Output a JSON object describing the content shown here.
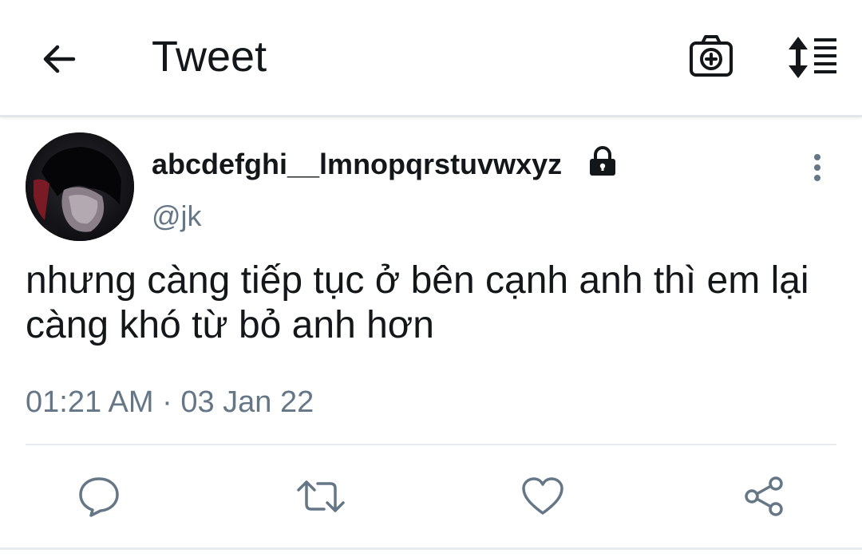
{
  "header": {
    "title": "Tweet",
    "back_icon": "arrow-left-icon",
    "camera_icon": "camera-add-icon",
    "sort_icon": "sort-list-icon"
  },
  "tweet": {
    "display_name": "abcdefghi__lmnopqrstuvwxyz",
    "handle": "@jk",
    "protected": true,
    "text": "nhưng càng tiếp tục ở bên cạnh anh thì em lại càng khó từ bỏ anh hơn",
    "timestamp": "01:21 AM · 03 Jan 22"
  },
  "actions": [
    {
      "name": "reply",
      "icon": "reply-icon"
    },
    {
      "name": "retweet",
      "icon": "retweet-icon"
    },
    {
      "name": "like",
      "icon": "heart-icon"
    },
    {
      "name": "share",
      "icon": "share-icon"
    }
  ],
  "colors": {
    "text_primary": "#14171a",
    "text_secondary": "#657786",
    "icon_gray": "#657786",
    "divider": "#e6ecf0"
  }
}
